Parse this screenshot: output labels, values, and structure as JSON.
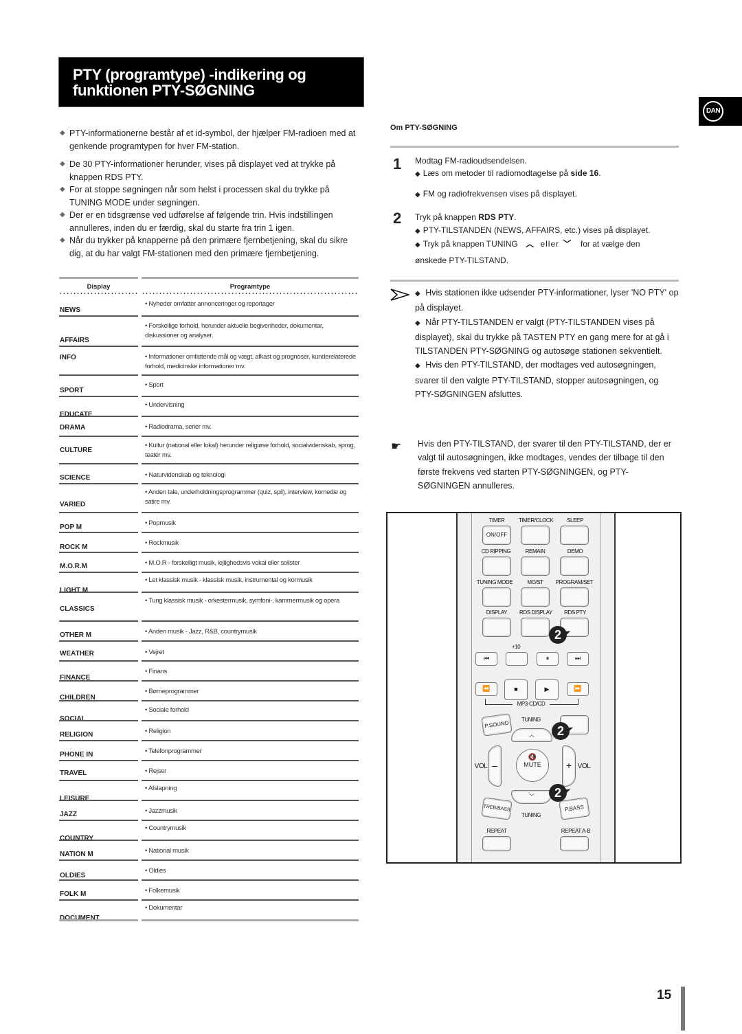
{
  "title": {
    "line1": "PTY (programtype) -indikering og",
    "line2": "funktionen PTY-SØGNING"
  },
  "language_tab": "DAN",
  "intro_bullets": [
    "PTY-informationerne består af et id-symbol, der hjælper FM-radioen med at genkende programtypen for hver FM-station.",
    "De 30 PTY-informationer herunder, vises på displayet ved at trykke på knappen RDS PTY.",
    "For at stoppe søgningen når som helst i processen skal du trykke på TUNING MODE under søgningen.",
    "Der er en tidsgrænse ved udførelse af følgende trin. Hvis indstillingen annulleres, inden du er færdig, skal du starte fra trin 1 igen.",
    "Når du trykker på knapperne på den primære fjernbetjening, skal du sikre dig, at du har valgt FM-stationen med den primære fjernbetjening."
  ],
  "table": {
    "headers": [
      "Display",
      "Programtype"
    ],
    "rows": [
      {
        "code": "NEWS",
        "desc": "• Nyheder omfatter annonceringer og reportager"
      },
      {
        "code": "AFFAIRS",
        "desc": "• Forskellige forhold, herunder aktuelle begivenheder, dokumentar, diskussioner og analyser."
      },
      {
        "code": "INFO",
        "desc": "• Informationer omfattende mål og vægt, afkast og prognoser, kunderelaterede forhold, medicinske informationer mv."
      },
      {
        "code": "SPORT",
        "desc": "• Sport"
      },
      {
        "code": "EDUCATE",
        "desc": "• Undervisning"
      },
      {
        "code": "DRAMA",
        "desc": "• Radiodrama, serier mv."
      },
      {
        "code": "CULTURE",
        "desc": "• Kultur (national eller lokal) herunder religiøse forhold, socialvidenskab, sprog, teater mv."
      },
      {
        "code": "SCIENCE",
        "desc": "• Naturvidenskab og teknologi"
      },
      {
        "code": "VARIED",
        "desc": "• Anden tale, underholdningsprogrammer (quiz, spil), interview, komedie og satire mv."
      },
      {
        "code": "POP M",
        "desc": "• Popmusik"
      },
      {
        "code": "ROCK M",
        "desc": "• Rockmusik"
      },
      {
        "code": "M.O.R.M",
        "desc": "• M.O.R - forskelligt musik, lejlighedsvis vokal eller solister"
      },
      {
        "code": "LIGHT M",
        "desc": "• Let klassisk musik - klassisk musik, instrumental og kormusik"
      },
      {
        "code": "CLASSICS",
        "desc": "• Tung klassisk musik - orkestermusik, symfoni-, kammermusik og opera"
      },
      {
        "code": "OTHER M",
        "desc": "• Anden musik - Jazz, R&B, countrymusik"
      },
      {
        "code": "WEATHER",
        "desc": "• Vejret"
      },
      {
        "code": "FINANCE",
        "desc": "• Finans"
      },
      {
        "code": "CHILDREN",
        "desc": "• Børneprogrammer"
      },
      {
        "code": "SOCIAL",
        "desc": "• Sociale forhold"
      },
      {
        "code": "RELIGION",
        "desc": "• Religion"
      },
      {
        "code": "PHONE IN",
        "desc": "• Telefonprogrammer"
      },
      {
        "code": "TRAVEL",
        "desc": "• Rejser"
      },
      {
        "code": "LEISURE",
        "desc": "• Afslapning"
      },
      {
        "code": "JAZZ",
        "desc": "• Jazzmusik"
      },
      {
        "code": "COUNTRY",
        "desc": "• Countrymusik"
      },
      {
        "code": "NATION M",
        "desc": "• National musik"
      },
      {
        "code": "OLDIES",
        "desc": "• Oldies"
      },
      {
        "code": "FOLK M",
        "desc": "• Folkemusik"
      },
      {
        "code": "DOCUMENT",
        "desc": "• Dokumentar"
      }
    ]
  },
  "om_heading": "Om PTY-SØGNING",
  "steps": {
    "s1_num": "1",
    "s1_text": "Modtag FM-radioudsendelsen.",
    "s1_b1_pre": "Læs om metoder til radiomodtagelse på ",
    "s1_b1_bold": "side 16",
    "s1_b1_post": ".",
    "s1_b2": "FM og radiofrekvensen vises på displayet.",
    "s2_num": "2",
    "s2_pre": "Tryk på knappen ",
    "s2_bold": "RDS PTY",
    "s2_post": ".",
    "s2_b1": "PTY-TILSTANDEN (NEWS, AFFAIRS, etc.) vises på displayet.",
    "s2_b2_pre": "Tryk på knappen TUNING",
    "s2_b2_mid": "eller",
    "s2_b2_post": "for at vælge den",
    "s2_b2_cont": "ønskede PTY-TILSTAND."
  },
  "note": {
    "b1": "Hvis stationen ikke udsender PTY-informationer, lyser 'NO PTY' op på displayet.",
    "b2": "Når PTY-TILSTANDEN er valgt (PTY-TILSTANDEN vises på displayet), skal du trykke på TASTEN PTY en gang mere for at gå i TILSTANDEN PTY-SØGNING og autosøge stationen sekventielt.",
    "b3": "Hvis den PTY-TILSTAND, der modtages ved autosøgningen, svarer til den valgte PTY-TILSTAND, stopper autosøgningen, og PTY-SØGNINGEN afsluttes."
  },
  "tip": "Hvis den PTY-TILSTAND, der svarer til den PTY-TILSTAND, der er valgt til autosøgningen, ikke modtages, vendes der tilbage til den første frekvens ved starten PTY-SØGNINGEN, og PTY-SØGNINGEN annulleres.",
  "remote": {
    "labels": {
      "timer": "TIMER",
      "timer_clock": "TIMER/CLOCK",
      "sleep": "SLEEP",
      "on_off": "ON/OFF",
      "cd_ripping": "CD RIPPING",
      "remain": "REMAIN",
      "demo": "DEMO",
      "tuning_mode": "TUNING MODE",
      "mo_st": "MO/ST",
      "program_set": "PROGRAM/SET",
      "display": "DISPLAY",
      "rds_display": "RDS DISPLAY",
      "rds_pty": "RDS PTY",
      "plus10": "+10",
      "mp3_cd": "MP3-CD/CD",
      "psound": "P.SOUND",
      "tuning_up": "TUNING",
      "tuning_down": "TUNING",
      "vol_left": "VOL",
      "vol_right": "VOL",
      "mute": "MUTE",
      "treb_bass": "TREB/BASS",
      "pbass": "P.BASS",
      "repeat": "REPEAT",
      "repeat_ab": "REPEAT A-B"
    },
    "step_badge": "2"
  },
  "page_number": "15"
}
